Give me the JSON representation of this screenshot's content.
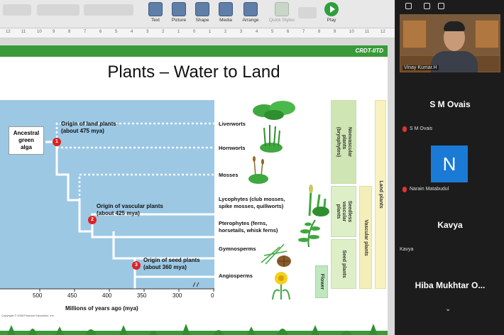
{
  "toolbar": {
    "buttons": [
      {
        "label": "Text",
        "icon": "text-box-icon"
      },
      {
        "label": "Picture",
        "icon": "picture-icon"
      },
      {
        "label": "Shape",
        "icon": "shape-icon"
      },
      {
        "label": "Media",
        "icon": "media-icon"
      },
      {
        "label": "Arrange",
        "icon": "arrange-icon"
      },
      {
        "label": "Quick Styles",
        "icon": "quick-styles-icon"
      },
      {
        "label": "Play",
        "icon": "play-icon"
      }
    ]
  },
  "ruler": {
    "ticks": [
      "12",
      "11",
      "10",
      "9",
      "8",
      "7",
      "6",
      "5",
      "4",
      "3",
      "2",
      "1",
      "0",
      "1",
      "2",
      "3",
      "4",
      "5",
      "6",
      "7",
      "8",
      "9",
      "10",
      "11",
      "12"
    ]
  },
  "slide": {
    "brand": "CRDT-IITD",
    "title": "Plants – Water to Land",
    "ancestral": [
      "Ancestral",
      "green",
      "alga"
    ],
    "callouts": [
      {
        "num": "1",
        "lines": [
          "Origin of land plants",
          "(about 475 mya)"
        ]
      },
      {
        "num": "2",
        "lines": [
          "Origin of vascular plants",
          "(about 425 mya)"
        ]
      },
      {
        "num": "3",
        "lines": [
          "Origin of seed plants",
          "(about 360 mya)"
        ]
      }
    ],
    "groups": [
      [
        "Liverworts"
      ],
      [
        "Hornworts"
      ],
      [
        "Mosses"
      ],
      [
        "Lycophytes (club mosses,",
        "spike mosses, quillworts)"
      ],
      [
        "Pterophytes (ferns,",
        "horsetails, whisk ferns)"
      ],
      [
        "Gymnosperms"
      ],
      [
        "Angiosperms"
      ]
    ],
    "axis": {
      "ticks": [
        "500",
        "450",
        "400",
        "350",
        "300",
        "0"
      ],
      "label": "Millions of years ago (mya)"
    },
    "copyright": "Copyright © 2008 Pearson Education, Inc.",
    "classification": {
      "nonvascular": [
        "Nonvascular",
        "plants",
        "(bryophytes)"
      ],
      "seedless": [
        "Seedless",
        "vascular",
        "plants"
      ],
      "seed": "Seed plants",
      "vascular": "Vascular plants",
      "land": "Land plants",
      "flower": "Flower"
    },
    "colors": {
      "green_bar": "#3a9a3a",
      "blue_panel": "#9cc8e4",
      "marker": "#d22222"
    }
  },
  "panel": {
    "presenter_name": "Vinay Kumar.H",
    "participants": [
      {
        "display": "S M Ovais",
        "label": "S M Ovais"
      },
      {
        "display": "N",
        "label": "Narain Matabudul"
      },
      {
        "display": "Kavya",
        "label": "Kavya"
      },
      {
        "display": "Hiba Mukhtar O..."
      }
    ]
  }
}
